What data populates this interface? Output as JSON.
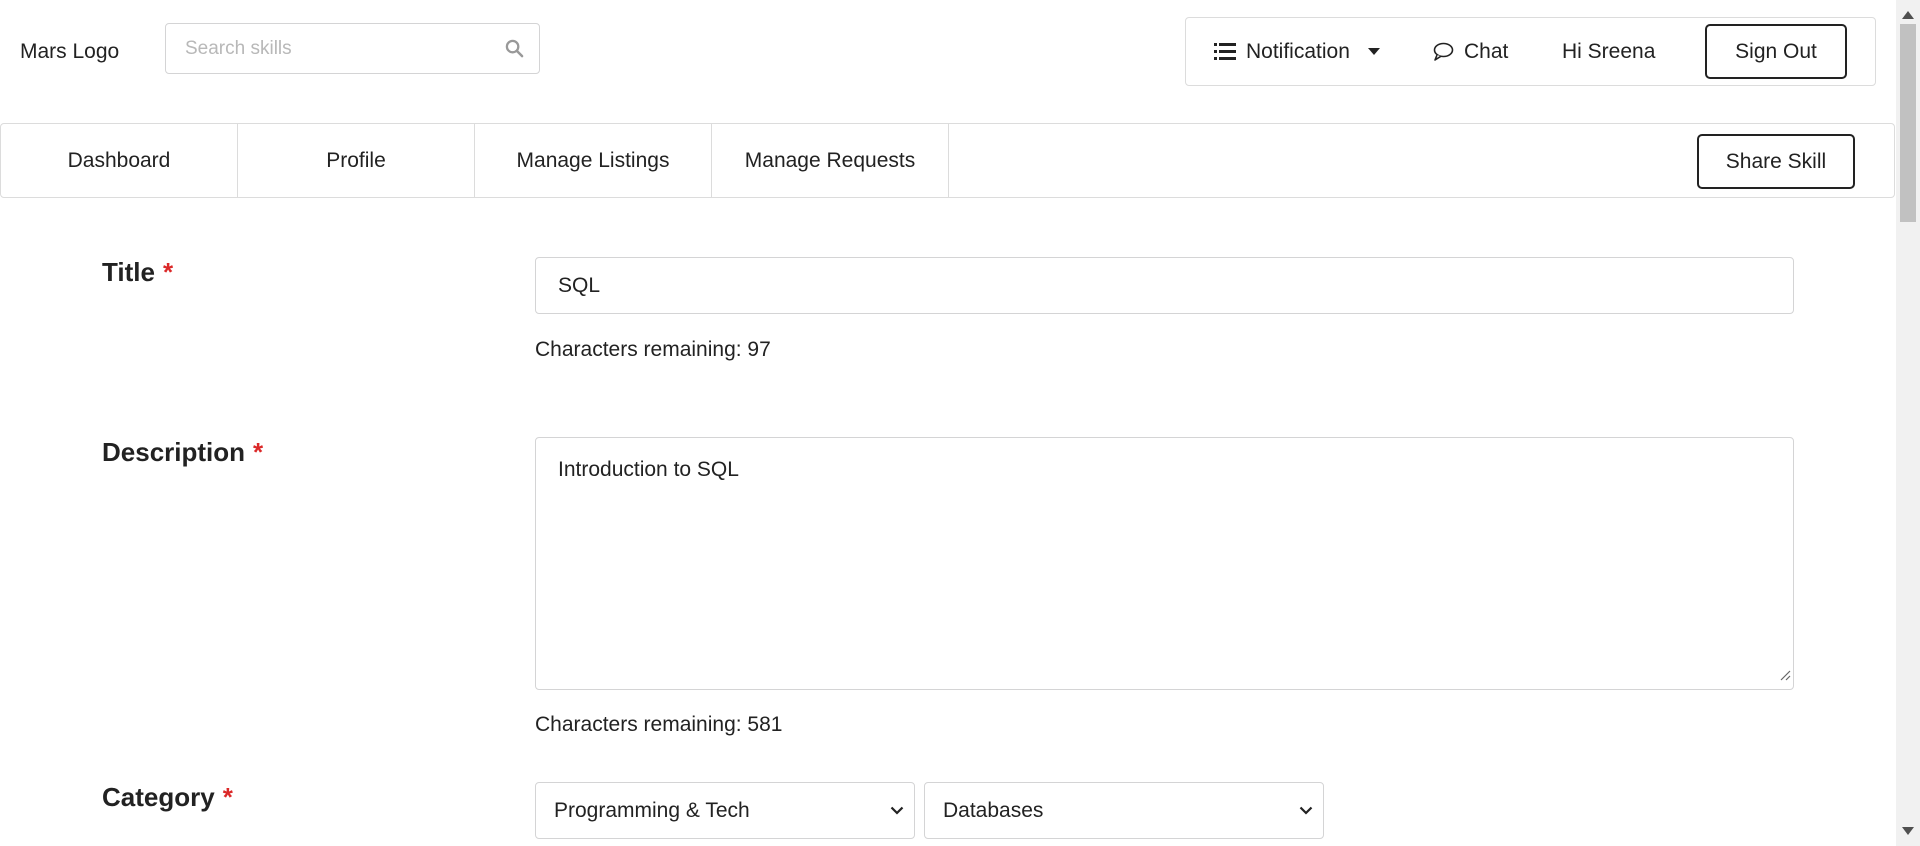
{
  "header": {
    "logo": "Mars Logo",
    "search_placeholder": "Search skills",
    "notification_label": "Notification",
    "chat_label": "Chat",
    "greeting": "Hi Sreena",
    "signout_label": "Sign Out"
  },
  "nav": {
    "tabs": [
      {
        "label": "Dashboard"
      },
      {
        "label": "Profile"
      },
      {
        "label": "Manage Listings"
      },
      {
        "label": "Manage Requests"
      }
    ],
    "share_label": "Share Skill"
  },
  "form": {
    "required_mark": "*",
    "title": {
      "label": "Title",
      "value": "SQL",
      "remaining": "Characters remaining: 97"
    },
    "description": {
      "label": "Description",
      "value": "Introduction to SQL",
      "remaining": "Characters remaining: 581"
    },
    "category": {
      "label": "Category",
      "selected": "Programming & Tech",
      "subcategory_selected": "Databases"
    }
  },
  "colors": {
    "required": "#db2828",
    "border": "#d4d4d5"
  }
}
